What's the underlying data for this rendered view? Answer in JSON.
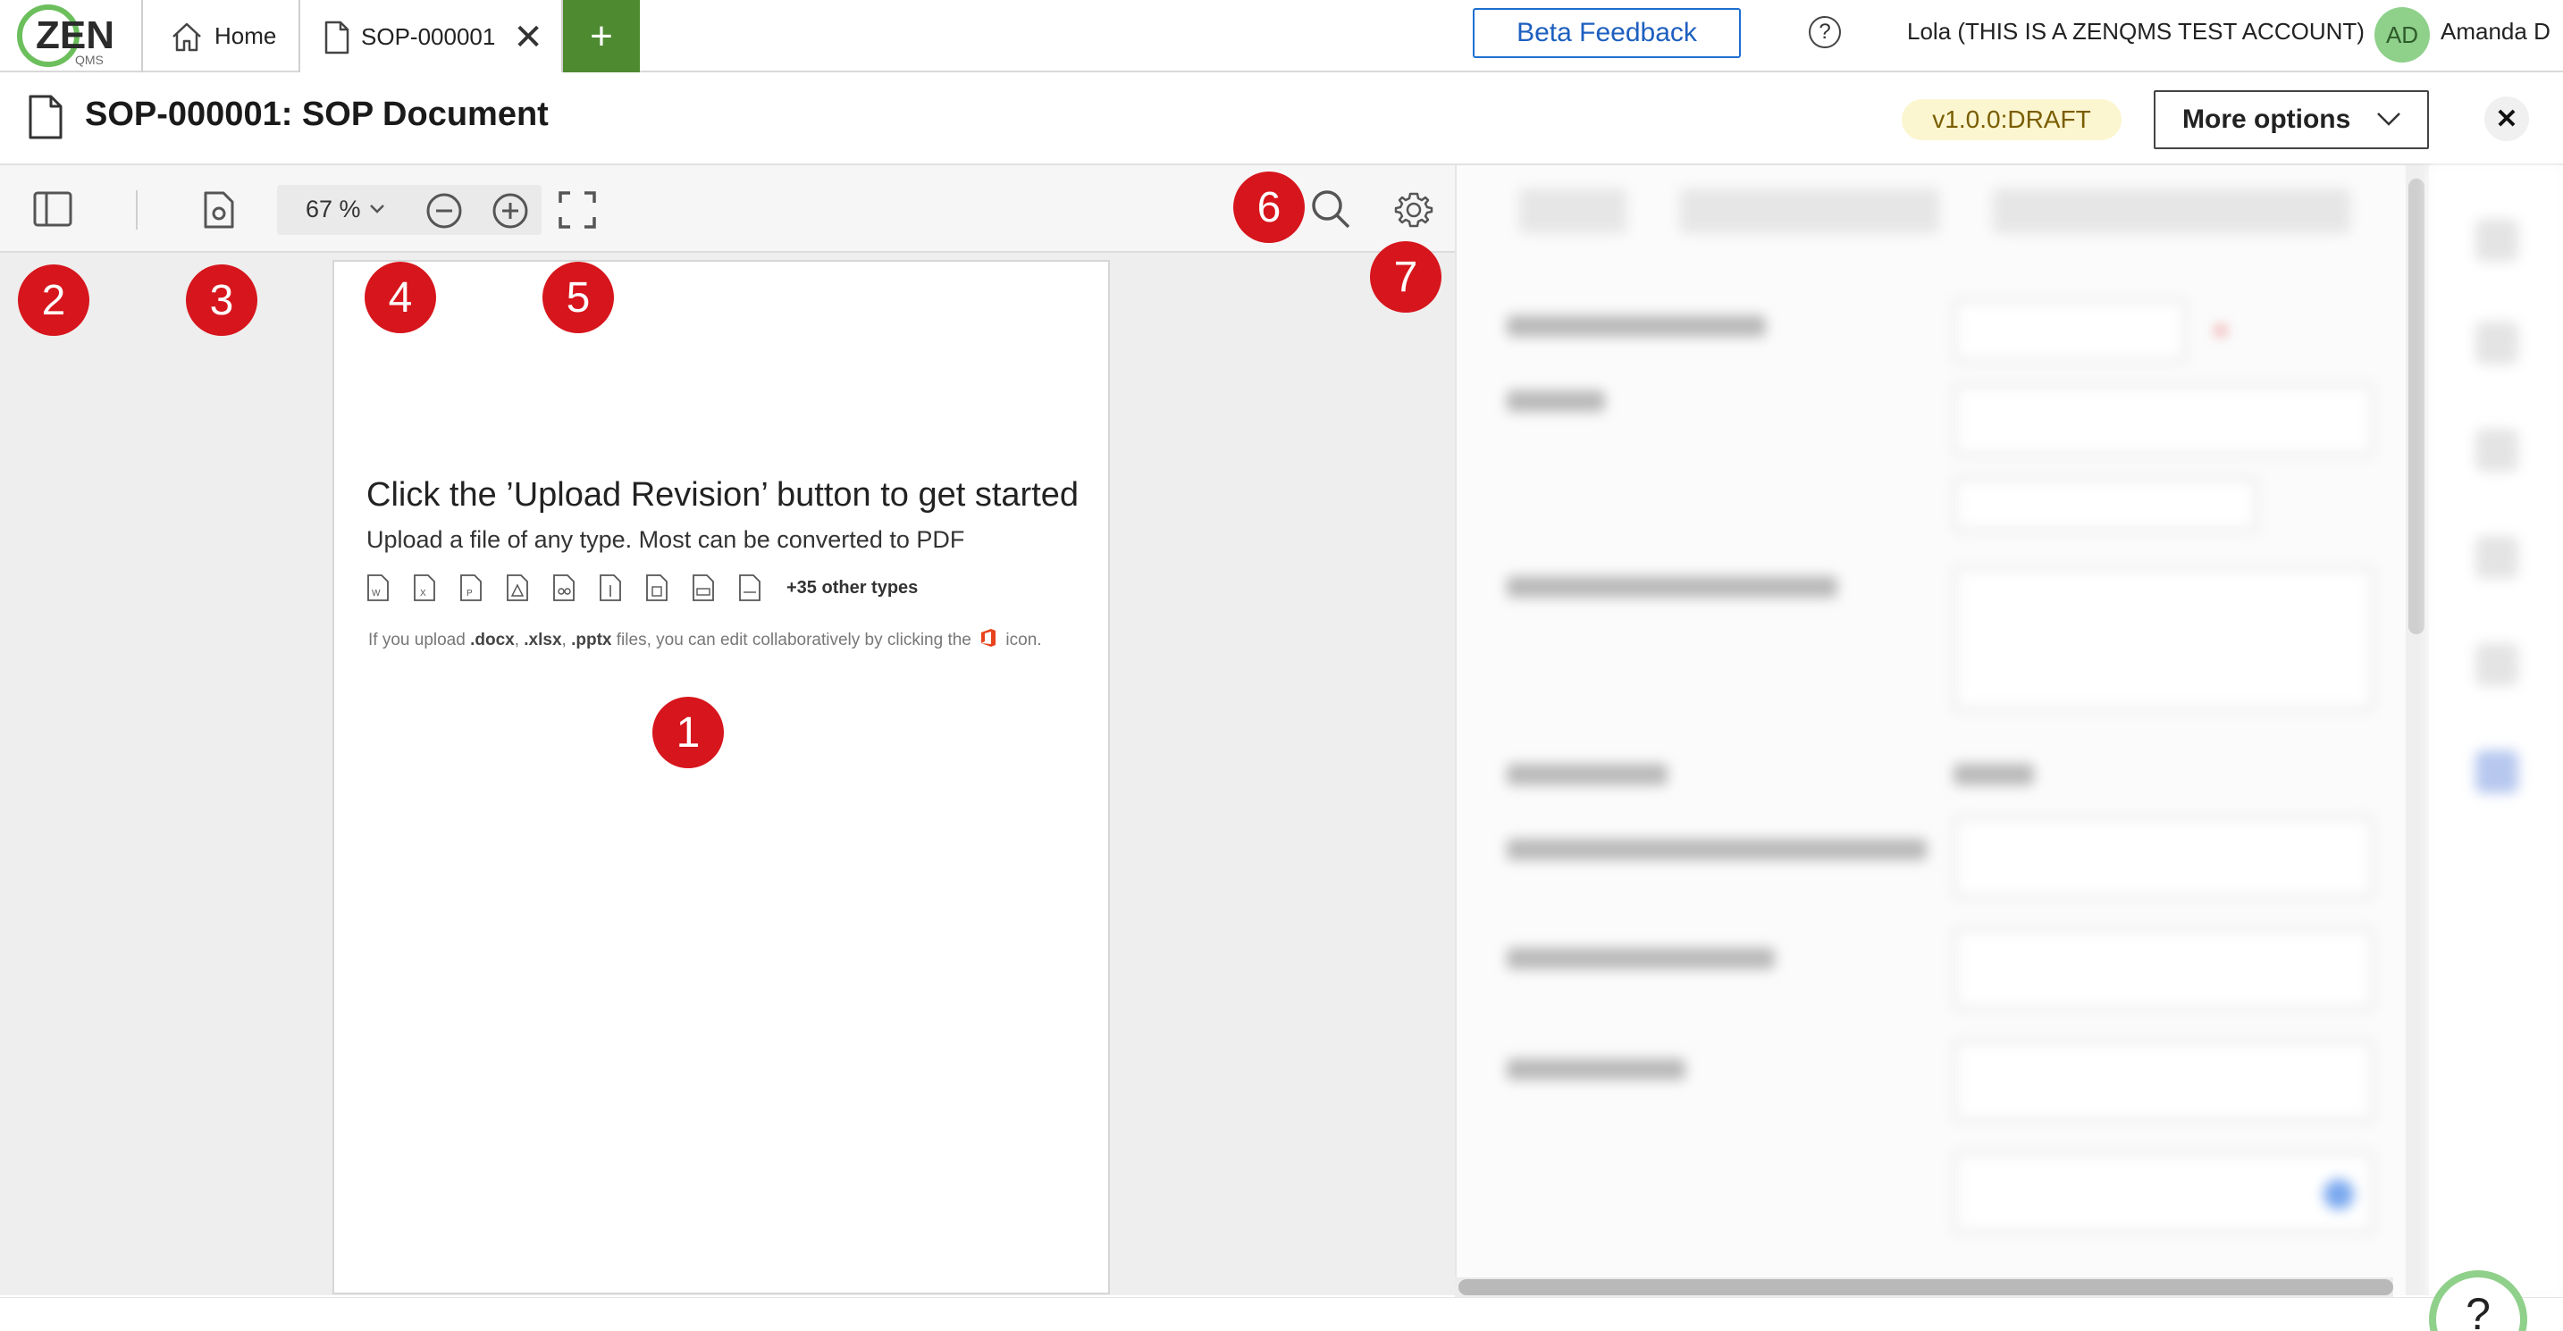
{
  "topbar": {
    "logo_text": "ZEN",
    "logo_subtext": "QMS",
    "home_tab_label": "Home",
    "doc_tab_label": "SOP-000001",
    "beta_feedback_label": "Beta Feedback",
    "account_label": "Lola (THIS IS A ZENQMS TEST ACCOUNT)",
    "avatar_initials": "AD",
    "user_name": "Amanda D"
  },
  "titlebar": {
    "title": "SOP-000001: SOP Document",
    "version": "v1.0.0:DRAFT",
    "more_options_label": "More options"
  },
  "viewer": {
    "zoom": "67 %",
    "upload_heading": "Click the ’Upload Revision’ button to get started",
    "upload_sub": "Upload a file of any type. Most can be converted to PDF",
    "file_type_icons": [
      "word-file-icon",
      "excel-file-icon",
      "powerpoint-file-icon",
      "pdf-file-icon",
      "image-file-icon",
      "text-file-icon",
      "archive-file-icon",
      "csv-file-icon",
      "rtf-file-icon"
    ],
    "other_types": "+35 other types",
    "hint_prefix": "If you upload ",
    "hint_docx": ".docx",
    "hint_sep1": ", ",
    "hint_xlsx": ".xlsx",
    "hint_sep2": ", ",
    "hint_pptx": ".pptx",
    "hint_mid": " files, you can edit collaboratively by clicking the ",
    "hint_suffix": " icon."
  },
  "annotations": [
    "1",
    "2",
    "3",
    "4",
    "5",
    "6",
    "7"
  ],
  "help_float_label": "?",
  "colors": {
    "accent_green": "#4e8a30",
    "beta_blue": "#1d6fd1",
    "badge_red": "#d7151c",
    "version_bg": "#fbf6d0",
    "avatar_bg": "#8fd08a"
  }
}
